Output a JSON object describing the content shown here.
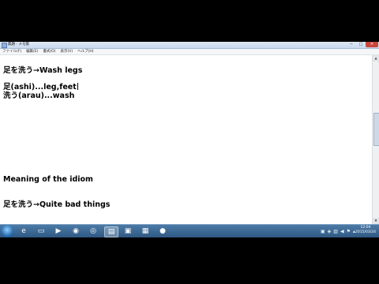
{
  "window": {
    "title": "無題 - メモ帳",
    "controls": {
      "minimize": "─",
      "maximize": "□",
      "close": "✕"
    }
  },
  "menu": [
    "ファイル(F)",
    "編集(E)",
    "書式(O)",
    "表示(V)",
    "ヘルプ(H)"
  ],
  "document": {
    "lines": [
      "足を洗う→Wash legs",
      "足(ashi)...leg,feet",
      "洗う(arau)...wash",
      "Meaning of the idiom",
      "足を洗う→Quite bad things"
    ]
  },
  "taskbar": {
    "items": [
      {
        "name": "internet-explorer",
        "glyph": "e"
      },
      {
        "name": "file-explorer",
        "glyph": "▭"
      },
      {
        "name": "media-player",
        "glyph": "▶"
      },
      {
        "name": "firefox",
        "glyph": "◉"
      },
      {
        "name": "chrome",
        "glyph": "◎"
      },
      {
        "name": "notepad",
        "glyph": "▤"
      },
      {
        "name": "document-app",
        "glyph": "▣"
      },
      {
        "name": "capture-app",
        "glyph": "▦"
      },
      {
        "name": "recorder-app",
        "glyph": "●"
      }
    ],
    "clock": {
      "time": "12:04",
      "date": "2015/03/24"
    }
  },
  "colors": {
    "taskbar": "#2d5682",
    "close_button": "#c9463d"
  }
}
